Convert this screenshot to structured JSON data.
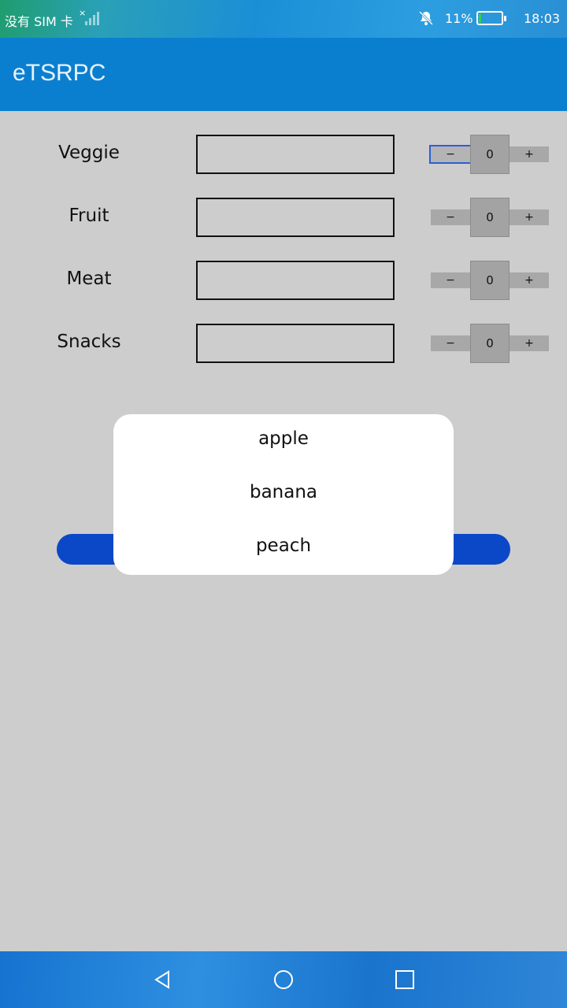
{
  "status_bar": {
    "carrier": "没有 SIM 卡",
    "signal_x": "×",
    "battery_percent": "11%",
    "battery_level": 0.11,
    "time": "18:03",
    "icons": [
      "no-signal-icon",
      "bell-muted-icon",
      "battery-icon"
    ]
  },
  "app_bar": {
    "title": "eTSRPC"
  },
  "rows": [
    {
      "label": "Veggie",
      "value": "0",
      "minus": "−",
      "plus": "+"
    },
    {
      "label": "Fruit",
      "value": "0",
      "minus": "−",
      "plus": "+"
    },
    {
      "label": "Meat",
      "value": "0",
      "minus": "−",
      "plus": "+"
    },
    {
      "label": "Snacks",
      "value": "0",
      "minus": "−",
      "plus": "+"
    }
  ],
  "popup": {
    "options": [
      "apple",
      "banana",
      "peach"
    ]
  },
  "nav_bar": {
    "icons": [
      "back-icon",
      "home-icon",
      "recents-icon"
    ]
  },
  "colors": {
    "app_bar": "#0b7fcf",
    "background": "#cdcdcd",
    "button": "#0a48c8"
  }
}
